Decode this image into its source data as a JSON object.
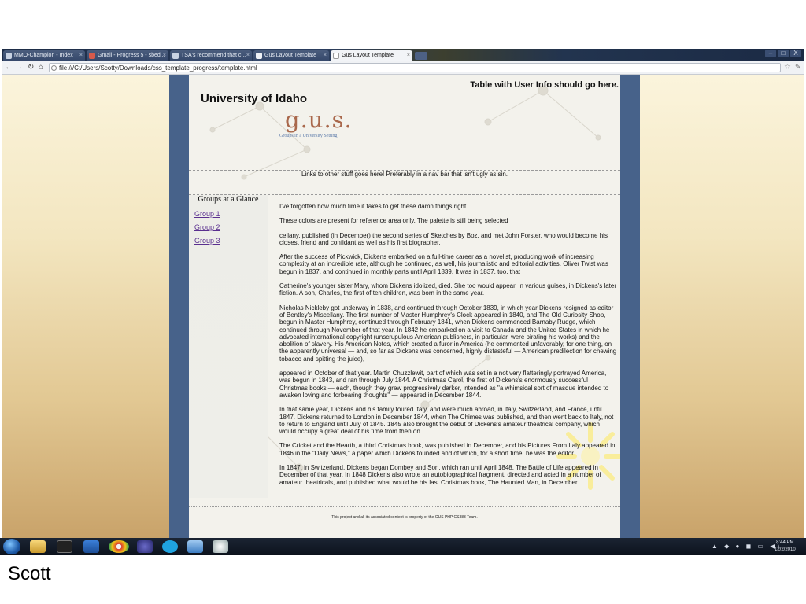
{
  "browser": {
    "tabs": [
      {
        "label": "MMO-Champion - Index"
      },
      {
        "label": "Gmail - Progress 5 - sbed..."
      },
      {
        "label": "TSA's recommend that c..."
      },
      {
        "label": "Gus Layout Template"
      },
      {
        "label": "Gus Layout Template"
      }
    ],
    "url": "file:///C:/Users/Scotty/Downloads/css_template_progress/template.html",
    "window_controls": [
      "–",
      "□",
      "X"
    ]
  },
  "page": {
    "user_info": "Table with User Info should go here.",
    "site_title": "University  of  Idaho",
    "logo": "g.u.s.",
    "tagline": "Groups in a University Setting",
    "nav_text": "Links to other stuff goes here! Preferably in a nav bar that isn't ugly as sin.",
    "sidebar": {
      "title": "Groups at a Glance",
      "groups": [
        {
          "label": "Group 1"
        },
        {
          "label": "Group 2"
        },
        {
          "label": "Group 3"
        }
      ]
    },
    "paragraphs": [
      "I've forgotten how much time it takes to get these damn things right",
      "These colors are present for reference area only. The palette is still being selected",
      "cellany, published (in December) the second series of Sketches by Boz, and met John Forster, who would become his closest friend and confidant as well as his first biographer.",
      "After the success of Pickwick, Dickens embarked on a full-time career as a novelist, producing work of increasing complexity at an incredible rate, although he continued, as well, his journalistic and editorial activities. Oliver Twist was begun in 1837, and continued in monthly parts until April 1839. It was in 1837, too, that",
      "Catherine's younger sister Mary, whom Dickens idolized, died. She too would appear, in various guises, in Dickens's later fiction. A son, Charles, the first of ten children, was born in the same year.",
      "Nicholas Nickleby got underway in 1838, and continued through October 1839, in which year Dickens resigned as editor of Bentley's Miscellany. The first number of Master Humphrey's Clock appeared in 1840, and The Old Curiosity Shop, begun in Master Humphrey, continued through February 1841, when Dickens commenced Barnaby Rudge, which continued through November of that year. In 1842 he embarked on a visit to Canada and the United States in which he advocated international copyright (unscrupulous American publishers, in particular, were pirating his works) and the abolition of slavery. His American Notes, which created a furor in America (he commented unfavorably, for one thing, on the apparently universal — and, so far as Dickens was concerned, highly distasteful — American predilection for chewing tobacco and spitting the juice),",
      "appeared in October of that year. Martin Chuzzlewit, part of which was set in a not very flatteringly portrayed America, was begun in 1843, and ran through July 1844. A Christmas Carol, the first of Dickens's enormously successful Christmas books — each, though they grew progressively darker, intended as \"a whimsical sort of masque intended to awaken loving and forbearing thoughts\" — appeared in December 1844.",
      "In that same year, Dickens and his family toured Italy, and were much abroad, in Italy, Switzerland, and France, until 1847. Dickens returned to London in December 1844, when The Chimes was published, and then went back to Italy, not to return to England until July of 1845. 1845 also brought the debut of Dickens's amateur theatrical company, which would occupy a great deal of his time from then on.",
      "The Cricket and the Hearth, a third Christmas book, was published in December, and his Pictures From Italy appeared in 1846 in the \"Daily News,\" a paper which Dickens founded and of which, for a short time, he was the editor.",
      "In 1847, in Switzerland, Dickens began Dombey and Son, which ran until April 1848. The Battle of Life appeared in December of that year. In 1848 Dickens also wrote an autobiographical fragment, directed and acted in a number of amateur theatricals, and published what would be his last Christmas book, The Haunted Man, in December"
    ],
    "footer": "This project and all its associated content is property of the GUS PHP CS383 Team."
  },
  "taskbar": {
    "clock_time": "8:44 PM",
    "clock_date": "12/2/2010",
    "tray": "▲ ◆ ● ◼ ▭ ◀)"
  },
  "caption": "Scott",
  "colors": {
    "page_border": "#47628a",
    "logo": "#a9684c",
    "link": "#5a2f8f"
  }
}
